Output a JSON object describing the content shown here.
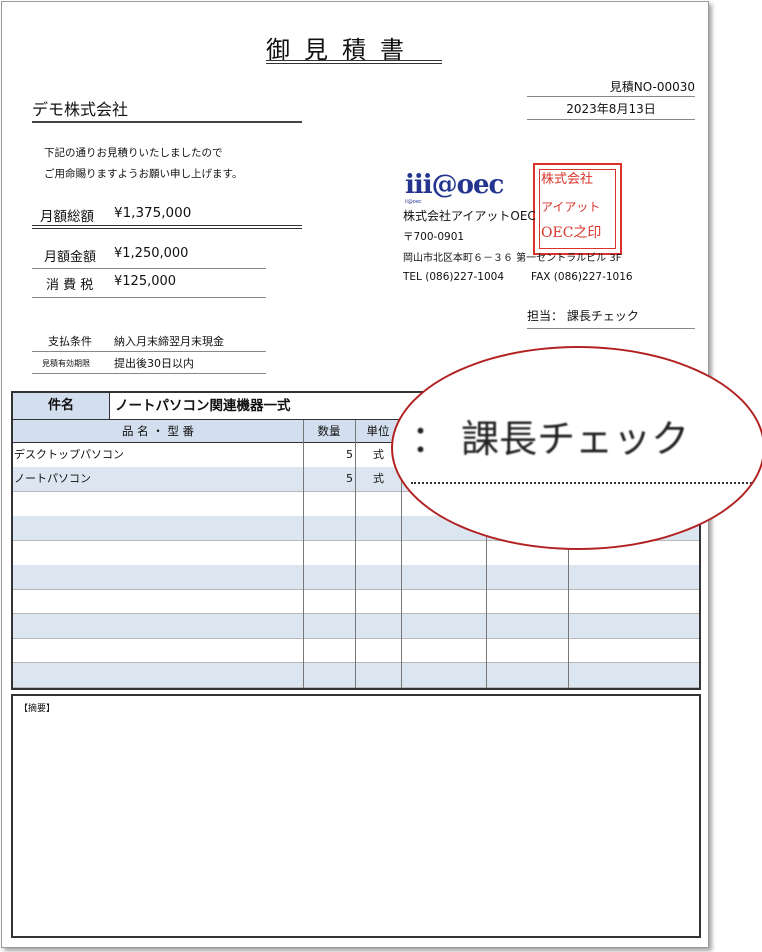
{
  "header": {
    "title": "御見積書",
    "estimate_no": "見積NO-00030",
    "date": "2023年8月13日"
  },
  "customer": {
    "name": "デモ株式会社",
    "intro_line1": "下記の通りお見積りいたしましたので",
    "intro_line2": "ご用命賜りますようお願い申し上げます。"
  },
  "amounts": {
    "total_label": "月額総額",
    "total_value": "¥1,375,000",
    "subtotal_label": "月額金額",
    "subtotal_value": "¥1,250,000",
    "tax_label": "消 費 税",
    "tax_value": "¥125,000"
  },
  "terms": {
    "payment_label": "支払条件",
    "payment_value": "納入月末締翌月末現金",
    "validity_label": "見積有効期限",
    "validity_value": "提出後30日以内"
  },
  "issuer": {
    "logo_text": "iii@oec",
    "logo_sub": "ii@oec",
    "company": "株式会社アイアットOEC",
    "zip": "〒700-0901",
    "address": "岡山市北区本町６－３６ 第一セントラルビル 3F",
    "tel": "TEL (086)227-1004",
    "fax": "FAX (086)227-1016",
    "stamp_lines": [
      "株式会社",
      "アイアット",
      "OEC之印"
    ],
    "person_label": "担当：",
    "person": "課長チェック"
  },
  "table": {
    "subject_label": "件名",
    "subject_value": "ノートパソコン関連機器一式",
    "headers": [
      "品 名 ・ 型 番",
      "数量",
      "単位"
    ],
    "rows": [
      {
        "name": "デスクトップパソコン",
        "qty": "5",
        "unit": "式"
      },
      {
        "name": "ノートパソコン",
        "qty": "5",
        "unit": "式"
      },
      {
        "name": "",
        "qty": "",
        "unit": ""
      },
      {
        "name": "",
        "qty": "",
        "unit": ""
      },
      {
        "name": "",
        "qty": "",
        "unit": ""
      },
      {
        "name": "",
        "qty": "",
        "unit": ""
      },
      {
        "name": "",
        "qty": "",
        "unit": ""
      },
      {
        "name": "",
        "qty": "",
        "unit": ""
      },
      {
        "name": "",
        "qty": "",
        "unit": ""
      },
      {
        "name": "",
        "qty": "",
        "unit": ""
      }
    ]
  },
  "remarks": {
    "label": "【摘要】"
  },
  "magnifier": {
    "text": "：  課長チェック"
  }
}
